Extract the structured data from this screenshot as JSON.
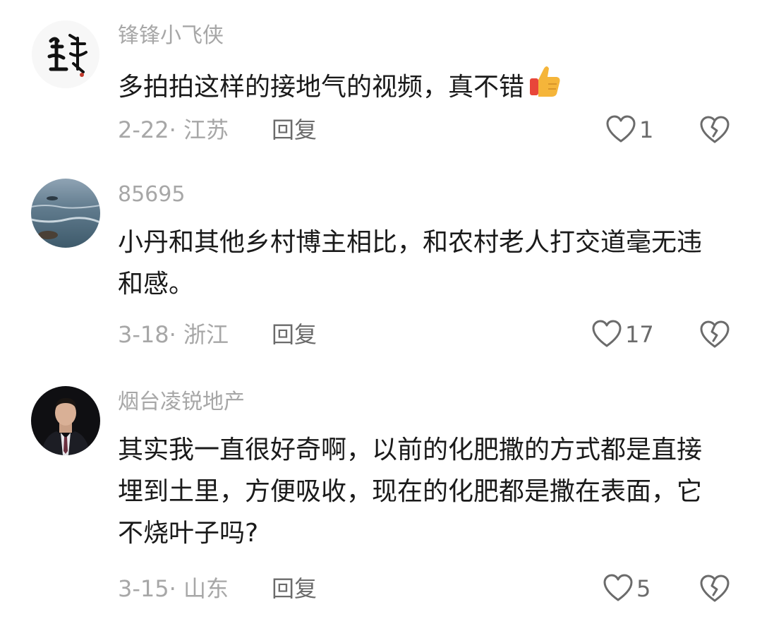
{
  "comments": [
    {
      "username": "锋锋小飞侠",
      "text": "多拍拍这样的接地气的视频，真不错",
      "emoji": "thumbs-up-emoji",
      "date": "2-22",
      "location": "· 江苏",
      "reply_label": "回复",
      "likes": "1"
    },
    {
      "username": "85695",
      "text": "小丹和其他乡村博主相比，和农村老人打交道毫无违和感。",
      "date": "3-18",
      "location": "· 浙江",
      "reply_label": "回复",
      "likes": "17"
    },
    {
      "username": "烟台凌锐地产",
      "text": "其实我一直很好奇啊，以前的化肥撒的方式都是直接埋到土里，方便吸收，现在的化肥都是撒在表面，它不烧叶子吗?",
      "date": "3-15",
      "location": "· 山东",
      "reply_label": "回复",
      "likes": "5"
    }
  ],
  "colors": {
    "secondary_text": "#a7a7a7",
    "primary_text": "#1a1a1a",
    "icon": "#6b6b6b"
  }
}
